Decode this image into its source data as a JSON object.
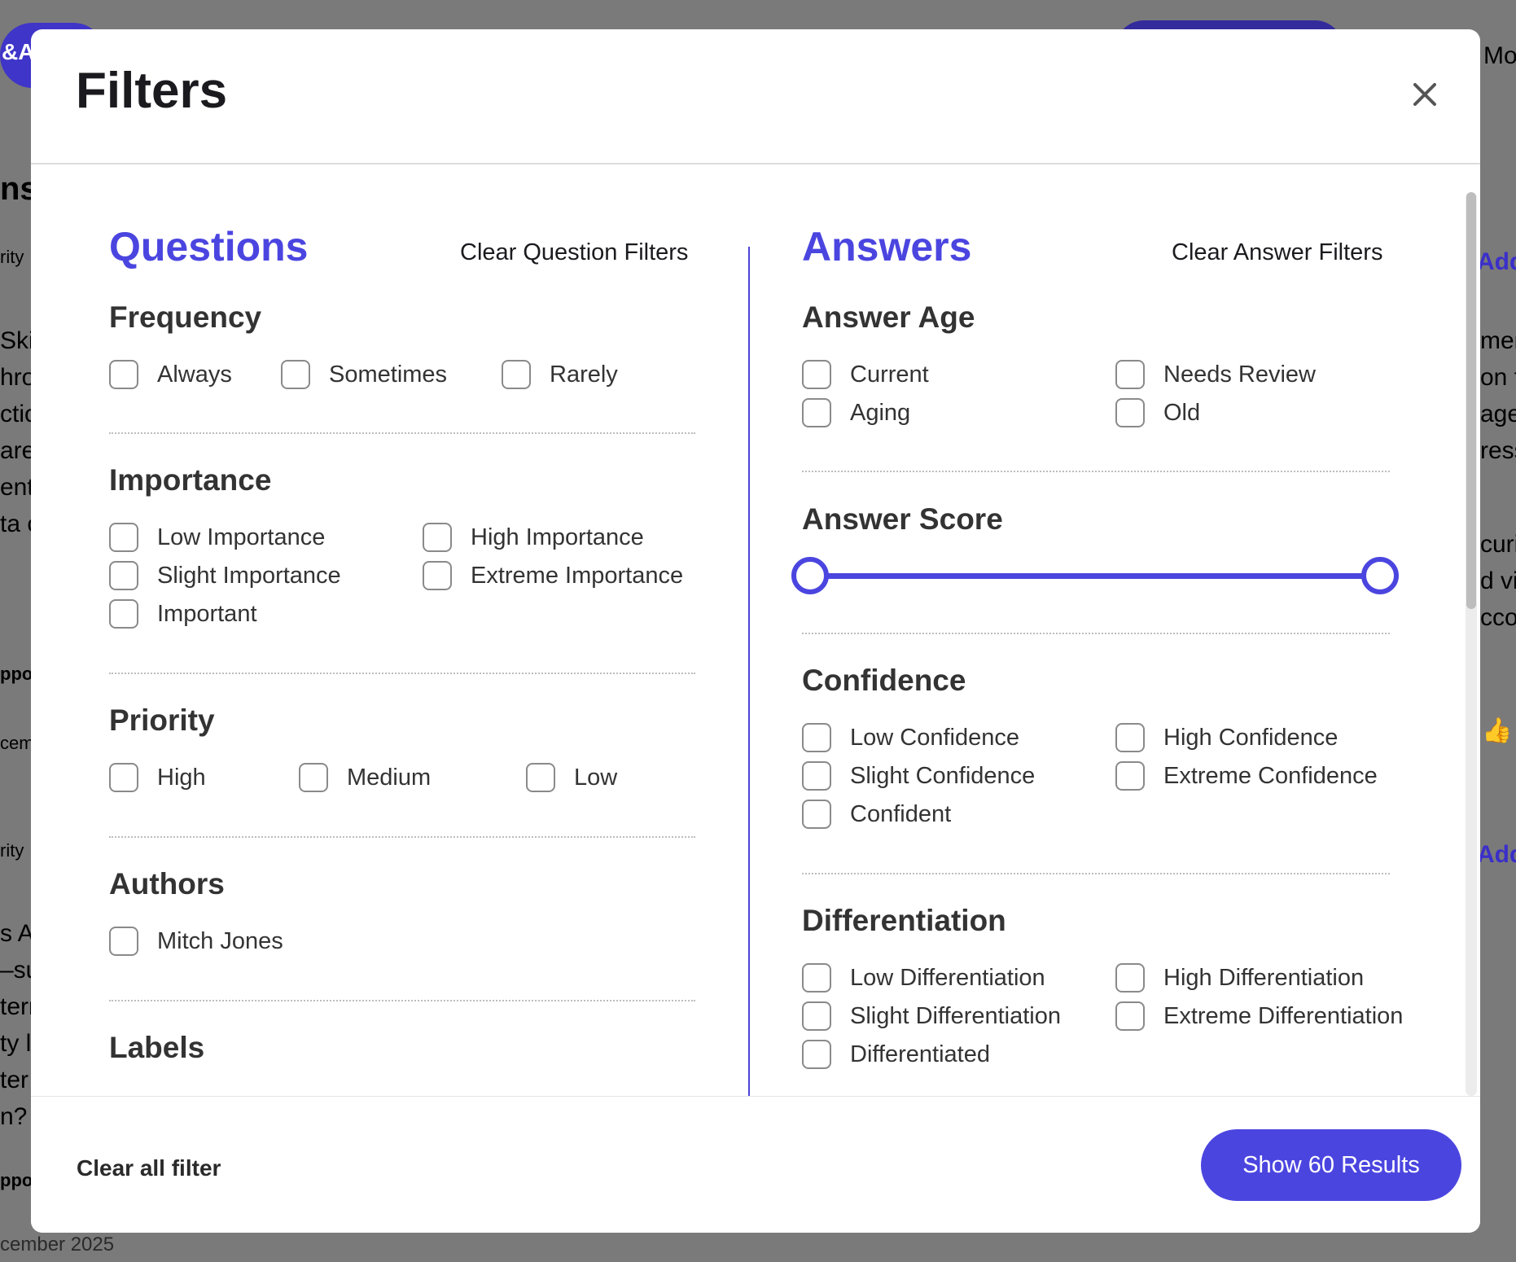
{
  "modal": {
    "title": "Filters",
    "close_icon": "close-icon"
  },
  "questions": {
    "heading": "Questions",
    "clear_label": "Clear Question Filters",
    "frequency": {
      "title": "Frequency",
      "options": [
        "Always",
        "Sometimes",
        "Rarely"
      ]
    },
    "importance": {
      "title": "Importance",
      "options": [
        "Low Importance",
        "High Importance",
        "Slight Importance",
        "Extreme Importance",
        "Important"
      ]
    },
    "priority": {
      "title": "Priority",
      "options": [
        "High",
        "Medium",
        "Low"
      ]
    },
    "authors": {
      "title": "Authors",
      "options": [
        "Mitch Jones"
      ]
    },
    "labels": {
      "title": "Labels"
    }
  },
  "answers": {
    "heading": "Answers",
    "clear_label": "Clear Answer Filters",
    "age": {
      "title": "Answer Age",
      "options": [
        "Current",
        "Needs Review",
        "Aging",
        "Old"
      ]
    },
    "score": {
      "title": "Answer Score",
      "range": [
        0,
        1
      ]
    },
    "confidence": {
      "title": "Confidence",
      "options": [
        "Low Confidence",
        "High Confidence",
        "Slight Confidence",
        "Extreme Confidence",
        "Confident"
      ]
    },
    "differentiation": {
      "title": "Differentiation",
      "options": [
        "Low Differentiation",
        "High Differentiation",
        "Slight Differentiation",
        "Extreme Differentiation",
        "Differentiated"
      ]
    }
  },
  "footer": {
    "clear_all_label": "Clear all filter",
    "show_results_label": "Show 60 Results"
  },
  "background": {
    "left_fragments": [
      "&A",
      "ns",
      "rity",
      "Skil",
      "hro",
      "ctio",
      "are",
      "ent.",
      "ta c",
      "ppo",
      "cem",
      "rity",
      "s Al",
      "–su",
      "tern",
      "ty le",
      "ter",
      "n?",
      "ppo"
    ],
    "right_fragments": [
      "Mo",
      "Add",
      "mer",
      "on t",
      "age",
      "ress",
      "curi",
      "d via",
      "ccou",
      "Add"
    ],
    "bottom_text": "cember 2025"
  },
  "colors": {
    "accent": "#4b45e0",
    "overlay": "#7a7a7a"
  }
}
